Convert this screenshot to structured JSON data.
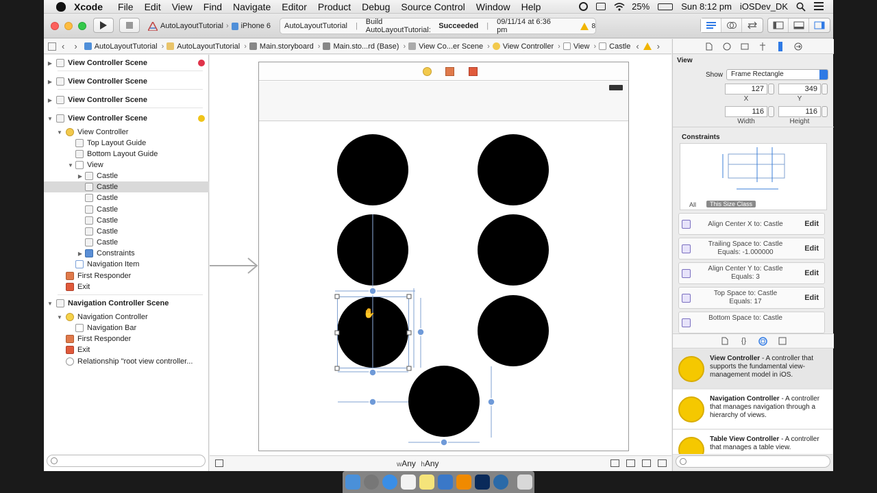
{
  "menubar": {
    "app_name": "Xcode",
    "items": [
      "File",
      "Edit",
      "View",
      "Find",
      "Navigate",
      "Editor",
      "Product",
      "Debug",
      "Source Control",
      "Window",
      "Help"
    ],
    "battery": "25%",
    "clock": "Sun 8:12 pm",
    "user": "iOSDev_DK"
  },
  "toolbar": {
    "scheme_target": "AutoLayoutTutorial",
    "scheme_device": "iPhone 6",
    "activity_project": "AutoLayoutTutorial",
    "activity_status_prefix": "Build AutoLayoutTutorial:",
    "activity_status": "Succeeded",
    "activity_time": "09/11/14 at 6:36 pm",
    "warning_count": "8"
  },
  "jumpbar": {
    "crumbs": [
      "AutoLayoutTutorial",
      "AutoLayoutTutorial",
      "Main.storyboard",
      "Main.sto...rd (Base)",
      "View Co...er Scene",
      "View Controller",
      "View",
      "Castle"
    ]
  },
  "navigator": {
    "scene1": "View Controller Scene",
    "scene2": "View Controller Scene",
    "scene3": "View Controller Scene",
    "scene4": "View Controller Scene",
    "view_controller": "View Controller",
    "top_guide": "Top Layout Guide",
    "bottom_guide": "Bottom Layout Guide",
    "view": "View",
    "castle": "Castle",
    "constraints": "Constraints",
    "navigation_item": "Navigation Item",
    "first_responder": "First Responder",
    "exit": "Exit",
    "nav_scene": "Navigation Controller Scene",
    "nav_controller": "Navigation Controller",
    "nav_bar": "Navigation Bar",
    "first_responder2": "First Responder",
    "exit2": "Exit",
    "relationship": "Relationship \"root view controller..."
  },
  "canvas": {
    "size_w": "w",
    "size_w_val": "Any",
    "size_h": "h",
    "size_h_val": "Any"
  },
  "inspector": {
    "section": "View",
    "show_label": "Show",
    "show_value": "Frame Rectangle",
    "x": "127",
    "y": "349",
    "width": "116",
    "height": "116",
    "x_label": "X",
    "y_label": "Y",
    "width_label": "Width",
    "height_label": "Height",
    "constraints_title": "Constraints",
    "filter_all": "All",
    "filter_size": "This Size Class",
    "constraints": [
      {
        "line1": "Align Center X to:  Castle",
        "line2": "",
        "edit": "Edit"
      },
      {
        "line1": "Trailing Space to:  Castle",
        "line2": "Equals:  -1.000000",
        "edit": "Edit"
      },
      {
        "line1": "Align Center Y to:  Castle",
        "line2": "Equals:  3",
        "edit": "Edit"
      },
      {
        "line1": "Top Space to:  Castle",
        "line2": "Equals:  17",
        "edit": "Edit"
      },
      {
        "line1": "Bottom Space to:  Castle",
        "line2": "",
        "edit": ""
      }
    ]
  },
  "library": {
    "items": [
      {
        "title": "View Controller",
        "desc": " - A controller that supports the fundamental view-management model in iOS."
      },
      {
        "title": "Navigation Controller",
        "desc": " - A controller that manages navigation through a hierarchy of views."
      },
      {
        "title": "Table View Controller",
        "desc": " - A controller that manages a table view."
      }
    ]
  },
  "colors": {
    "close": "#fc605c",
    "minimize": "#fdbc40",
    "zoom": "#34c84a",
    "accent_blue": "#2f7ae5"
  }
}
